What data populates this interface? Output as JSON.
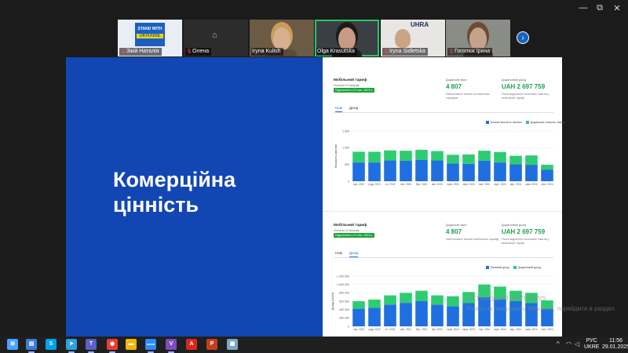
{
  "window": {
    "minimize": "—",
    "restore": "⧉",
    "close": "✕"
  },
  "participants": [
    {
      "name": "Зікій Наталія",
      "muted": true,
      "bg": "#e9eef6",
      "logo_top": "STAND WITH",
      "logo_bottom": "UKRAINE"
    },
    {
      "name": "Олена",
      "muted": true,
      "bg": "#2c2c2c"
    },
    {
      "name": "Iryna Kulish",
      "muted": false,
      "bg": "#6b5a44"
    },
    {
      "name": "Olga Krasutska",
      "muted": false,
      "bg": "#3a3f43",
      "active": true
    },
    {
      "name": "Iryna Sidletska",
      "muted": true,
      "bg": "#e8e6e2",
      "logo": "UHRA"
    },
    {
      "name": "Гоголюк Ірина",
      "muted": true,
      "bg": "#8a8c86"
    }
  ],
  "strip_next": "›",
  "slide": {
    "title": "Комерційна\nцінність",
    "colors": {
      "left_bg": "#1146b3",
      "bar_primary": "#1f6fe0",
      "bar_secondary": "#2ecc71",
      "accent_green": "#17a34a"
    },
    "panels": [
      {
        "label": "Мобільний тариф",
        "sub": "Останні 12 місяців",
        "badge": "Підключено з 21 лис. 2023 р.",
        "kpi1_caption": "Додаткові хвил",
        "kpi1_value": "4 807",
        "kpi1_note": "Заблоковано хвилин за місячним тарифом",
        "kpi2_caption": "Додатковий дохід",
        "kpi2_value": "UAH 2 697 759",
        "kpi2_note": "Після виділення голосових пакетів у мобільний тариф",
        "tabs": [
          "Нові",
          "Дохід"
        ],
        "selected_tab": 0,
        "legend": [
          "Базова кількість хвилин",
          "Додаткова кількість хвилин"
        ],
        "ylabel": "Кількість хвилин",
        "chart_data": {
          "type": "bar",
          "stacked": true,
          "categories": [
            "лис. 2023",
            "груд. 2023",
            "січ. 2024",
            "лют. 2024",
            "бер. 2024",
            "квіт. 2024",
            "трав. 2024",
            "черв. 2024",
            "лип. 2024",
            "серп. 2024",
            "вер. 2024",
            "жовт. 2024",
            "лист. 2024"
          ],
          "series": [
            {
              "name": "Базова кількість хвилин",
              "values": [
                560,
                560,
                620,
                610,
                640,
                620,
                530,
                520,
                610,
                560,
                510,
                490,
                340
              ]
            },
            {
              "name": "Додаткова кількість хвилин",
              "values": [
                320,
                320,
                300,
                300,
                300,
                280,
                260,
                280,
                300,
                310,
                250,
                280,
                150
              ]
            }
          ],
          "yticks": [
            "0",
            "500",
            "1 000",
            "1 500"
          ],
          "ylim": [
            0,
            1500
          ]
        }
      },
      {
        "label": "Мобільний тариф",
        "sub": "Останні 12 місяців",
        "badge": "Підключено з 21 лис. 2023 р.",
        "kpi1_caption": "Додаткові хвил",
        "kpi1_value": "4 807",
        "kpi1_note": "Заблоковано хвилин мобільного тарифу",
        "kpi2_caption": "Додатковий дохід",
        "kpi2_value": "UAH 2 697 759",
        "kpi2_note": "Після виділення голосових пакетів у мобільний тариф",
        "tabs": [
          "Нові",
          "Дохід"
        ],
        "selected_tab": 1,
        "legend": [
          "Базовий дохід",
          "Додатковий дохід"
        ],
        "ylabel": "Дохід (UAH)",
        "chart_data": {
          "type": "bar",
          "stacked": true,
          "categories": [
            "лис. 2023",
            "груд. 2023",
            "січ. 2024",
            "лют. 2024",
            "бер. 2024",
            "квіт. 2024",
            "трав. 2024",
            "черв. 2024",
            "лип. 2024",
            "серп. 2024",
            "вер. 2024",
            "жовт. 2024",
            "лист. 2024"
          ],
          "series": [
            {
              "name": "Базовий дохід",
              "values": [
                420000,
                440000,
                520000,
                560000,
                600000,
                520000,
                480000,
                560000,
                700000,
                650000,
                600000,
                560000,
                420000
              ]
            },
            {
              "name": "Додатковий дохід",
              "values": [
                180000,
                200000,
                220000,
                240000,
                250000,
                220000,
                240000,
                260000,
                300000,
                300000,
                250000,
                240000,
                200000
              ]
            }
          ],
          "yticks": [
            "0",
            "200 000",
            "400 000",
            "600 000",
            "800 000",
            "1 000 000",
            "1 200 000"
          ],
          "ylim": [
            0,
            1200000
          ]
        }
      }
    ]
  },
  "watermark": {
    "line1": "Активация Windows",
    "line2": "Чтобы активировать Windows, перейдите в раздел"
  },
  "taskbar": {
    "apps": [
      {
        "icon": "start-icon",
        "color": "#4aa3ff",
        "glyph": "⊞"
      },
      {
        "icon": "search-icon",
        "color": "#2d2d2d",
        "glyph": "⌕"
      },
      {
        "icon": "notes-app-icon",
        "color": "#3b7ddd",
        "glyph": "▤"
      },
      {
        "icon": "skype-icon",
        "color": "#00a2ed",
        "glyph": "S"
      },
      {
        "icon": "telegram-icon",
        "color": "#2aa3df",
        "glyph": "➤"
      },
      {
        "icon": "teams-icon",
        "color": "#5b5fc7",
        "glyph": "T"
      },
      {
        "icon": "chrome-icon",
        "color": "#e34133",
        "glyph": "◉"
      },
      {
        "icon": "explorer-icon",
        "color": "#f2b705",
        "glyph": "▬"
      },
      {
        "icon": "zoom-icon",
        "color": "#2d8cff",
        "glyph": "zoom"
      },
      {
        "icon": "viber-icon",
        "color": "#7d4cbf",
        "glyph": "V"
      },
      {
        "icon": "acrobat-icon",
        "color": "#d7281e",
        "glyph": "A"
      },
      {
        "icon": "powerpoint-icon",
        "color": "#c43e1c",
        "glyph": "P"
      },
      {
        "icon": "docs-icon",
        "color": "#7aa7c7",
        "glyph": "▦"
      }
    ],
    "tray": {
      "chevron": "^",
      "lang_top": "РУС",
      "lang_bottom": "UKRE",
      "time": "11:56",
      "date": "29.01.2025"
    }
  }
}
